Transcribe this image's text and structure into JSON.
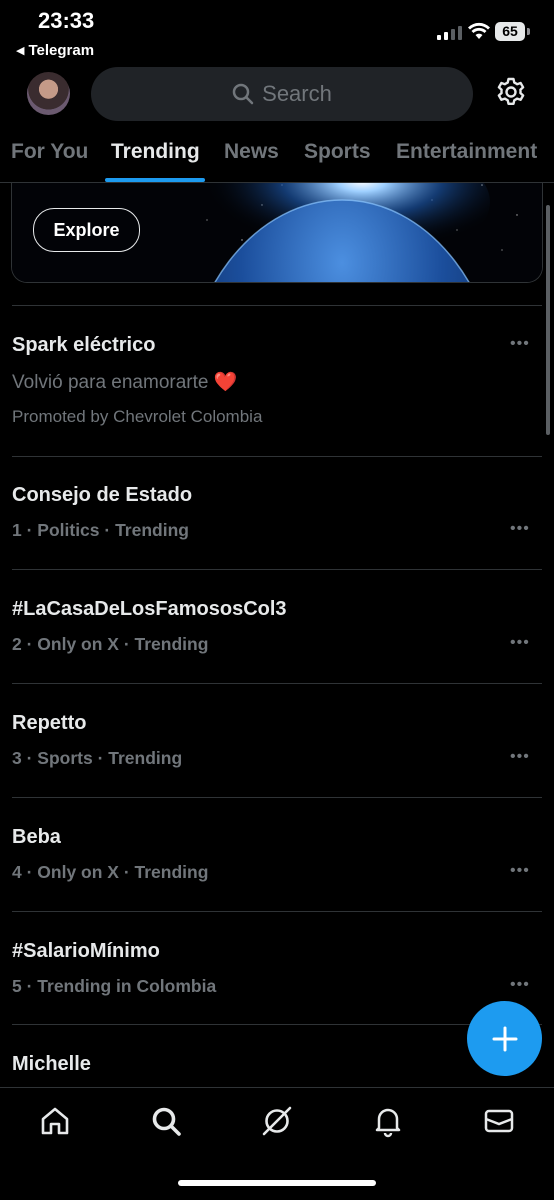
{
  "status_bar": {
    "time": "23:33",
    "back_app": "Telegram",
    "battery": "65"
  },
  "search": {
    "placeholder": "Search"
  },
  "tabs": [
    {
      "label": "For You"
    },
    {
      "label": "Trending"
    },
    {
      "label": "News"
    },
    {
      "label": "Sports"
    },
    {
      "label": "Entertainment"
    }
  ],
  "promo_card": {
    "button_label": "Explore"
  },
  "promoted": {
    "title": "Spark eléctrico",
    "subtitle": "Volvió para enamorarte",
    "emoji": "❤️",
    "sponsor": "Promoted by Chevrolet Colombia"
  },
  "trends": [
    {
      "title": "Consejo de Estado",
      "meta": "1 · Politics · Trending"
    },
    {
      "title": "#LaCasaDeLosFamososCol3",
      "meta": "2 · Only on X · Trending"
    },
    {
      "title": "Repetto",
      "meta": "3 · Sports · Trending"
    },
    {
      "title": "Beba",
      "meta": "4 · Only on X · Trending"
    },
    {
      "title": "#SalarioMínimo",
      "meta": "5 · Trending in Colombia"
    },
    {
      "title": "Michelle",
      "meta": ""
    }
  ],
  "more_label": "•••",
  "colors": {
    "accent": "#1d9bf0",
    "background": "#000000",
    "muted": "#71767b"
  },
  "bottom_nav": [
    "home-icon",
    "search-icon",
    "grok-icon",
    "notifications-icon",
    "messages-icon"
  ]
}
